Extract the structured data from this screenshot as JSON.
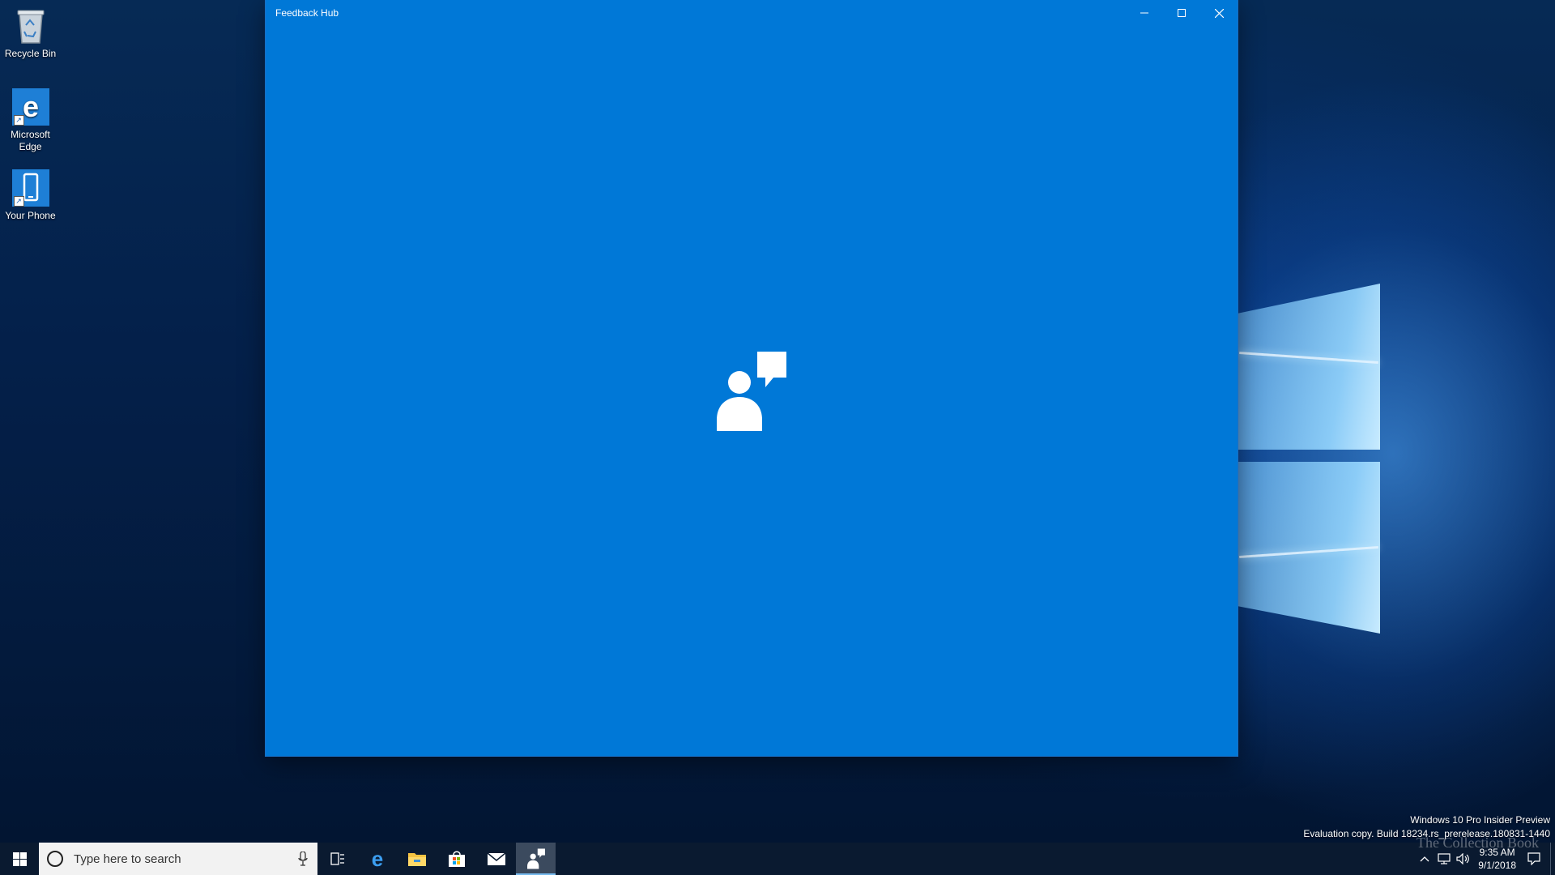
{
  "desktop": {
    "icons": [
      {
        "label": "Recycle Bin"
      },
      {
        "label": "Microsoft Edge"
      },
      {
        "label": "Your Phone"
      }
    ]
  },
  "window": {
    "title": "Feedback Hub",
    "background": "#0078d7"
  },
  "watermark": {
    "line1": "Windows 10 Pro Insider Preview",
    "line2": "Evaluation copy. Build 18234.rs_prerelease.180831-1440"
  },
  "taskbar": {
    "search_placeholder": "Type here to search",
    "pinned": [
      {
        "icon": "task-view-icon"
      },
      {
        "icon": "edge-icon"
      },
      {
        "icon": "file-explorer-icon"
      },
      {
        "icon": "store-icon"
      },
      {
        "icon": "mail-icon"
      },
      {
        "icon": "feedback-hub-icon",
        "active": true
      }
    ],
    "clock": {
      "time": "9:35 AM",
      "date": "9/1/2018"
    }
  },
  "overlay": {
    "text": "The Collection Book"
  },
  "colors": {
    "accent": "#0078d7",
    "taskbar": "#0a1a30"
  }
}
